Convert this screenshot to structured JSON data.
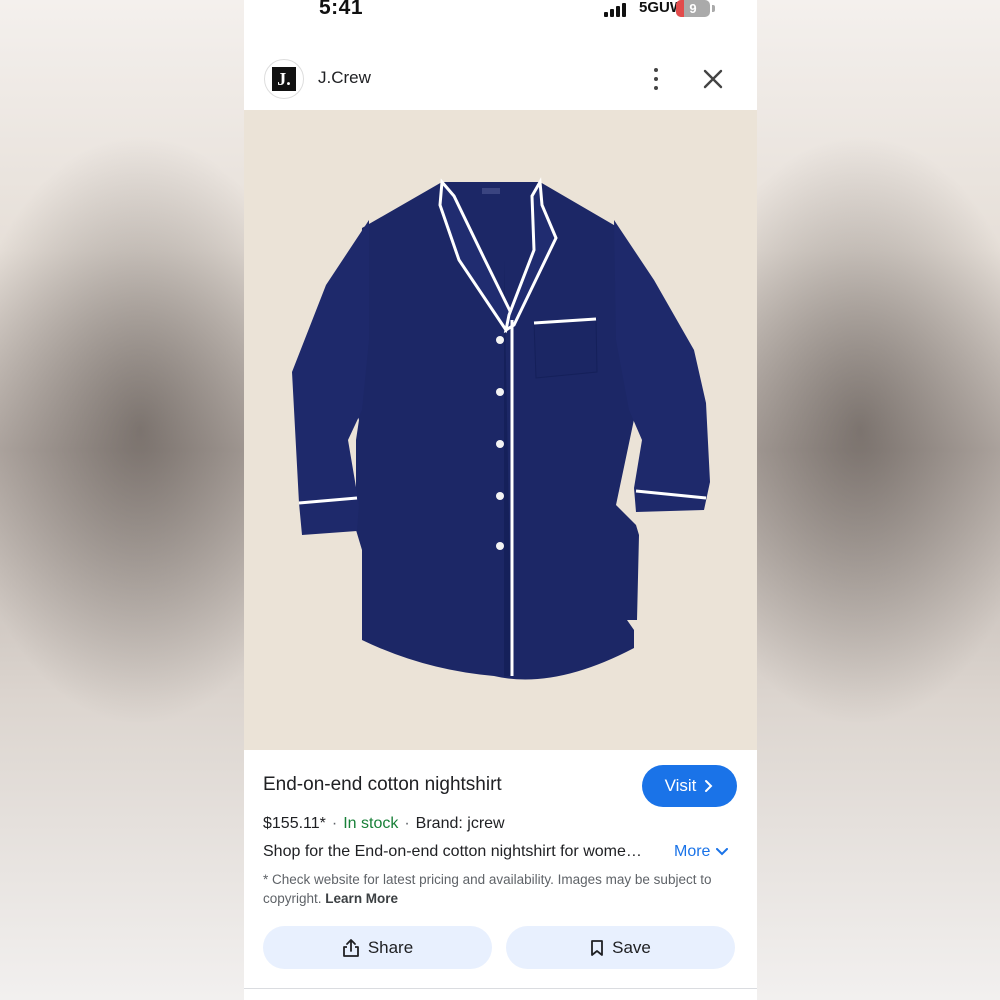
{
  "status_bar": {
    "time": "5:41",
    "network": "5GUW",
    "battery": "9"
  },
  "header": {
    "brand_logo_text": "J.",
    "brand_name": "J.Crew",
    "more_icon": "more-vert-icon",
    "close_icon": "close-icon"
  },
  "product": {
    "image_subject": "navy nightshirt with white piping",
    "title": "End-on-end cotton nightshirt",
    "visit_label": "Visit",
    "price": "$155.11*",
    "stock": "In stock",
    "brand": "Brand: jcrew",
    "description": "Shop for the End-on-end cotton nightshirt for wome…",
    "more_label": "More",
    "disclaimer": "* Check website for latest pricing and availability. Images may be subject to copyright.",
    "learn_more": "Learn More"
  },
  "actions": {
    "share_label": "Share",
    "save_label": "Save"
  },
  "colors": {
    "accent": "#1a73e8",
    "in_stock": "#188038",
    "button_bg": "#e8f0fe",
    "shirt": "#1c2766",
    "image_bg": "#ebe3d7"
  }
}
